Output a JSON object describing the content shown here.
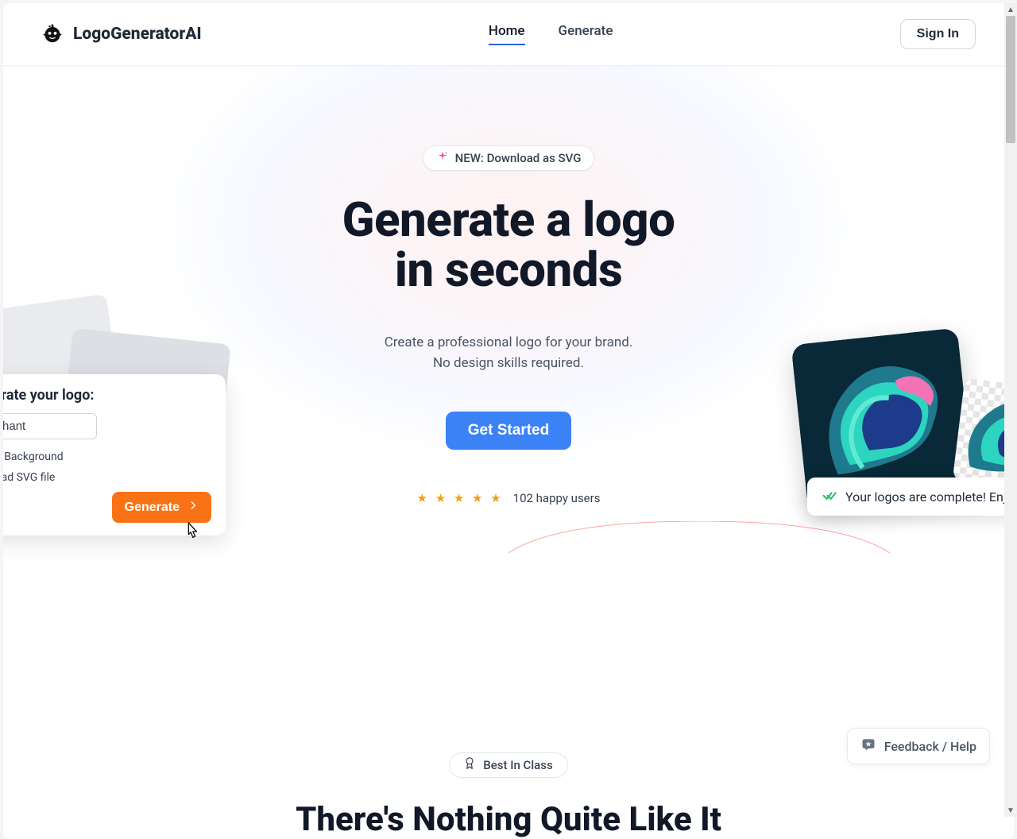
{
  "brand": {
    "name": "LogoGeneratorAI"
  },
  "nav": {
    "links": [
      {
        "label": "Home",
        "active": true
      },
      {
        "label": "Generate",
        "active": false
      }
    ],
    "signin": "Sign In"
  },
  "hero": {
    "badge": "NEW: Download as SVG",
    "title_line1": "Generate a logo",
    "title_line2": "in seconds",
    "subtitle_line1": "Create a professional logo for your brand.",
    "subtitle_line2": "No design skills required.",
    "cta": "Get Started",
    "stars": "★ ★ ★ ★ ★",
    "rating_text": "102 happy users"
  },
  "gen_card": {
    "title": "enerate your logo:",
    "input_value": "lephant",
    "option1": "nove Background",
    "option2": "wnload SVG file",
    "button": "Generate"
  },
  "toast": {
    "text": "Your logos are complete! Enjo"
  },
  "section2": {
    "badge": "Best In Class",
    "title": "There's Nothing Quite Like It"
  },
  "feedback": {
    "label": "Feedback / Help"
  }
}
